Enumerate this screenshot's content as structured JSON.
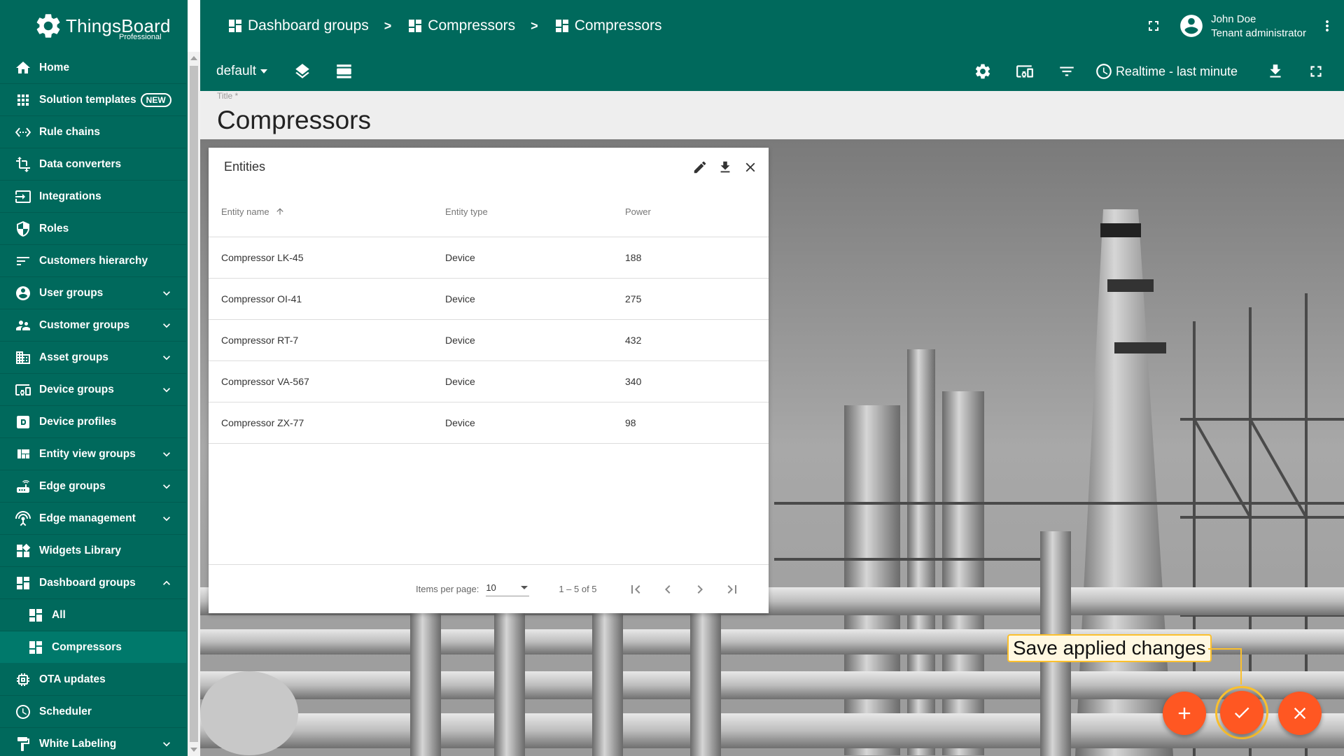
{
  "app": {
    "brand": "ThingsBoard",
    "edition": "Professional"
  },
  "sidebar": {
    "items": [
      {
        "label": "Home",
        "icon": "home-icon"
      },
      {
        "label": "Solution templates",
        "icon": "apps-icon",
        "badge": "NEW"
      },
      {
        "label": "Rule chains",
        "icon": "settings-ethernet-icon"
      },
      {
        "label": "Data converters",
        "icon": "transform-icon"
      },
      {
        "label": "Integrations",
        "icon": "input-icon"
      },
      {
        "label": "Roles",
        "icon": "security-icon"
      },
      {
        "label": "Customers hierarchy",
        "icon": "sort-icon"
      },
      {
        "label": "User groups",
        "icon": "account-circle-icon",
        "expandable": true
      },
      {
        "label": "Customer groups",
        "icon": "supervisor-account-icon",
        "expandable": true
      },
      {
        "label": "Asset groups",
        "icon": "domain-icon",
        "expandable": true
      },
      {
        "label": "Device groups",
        "icon": "devices-other-icon",
        "expandable": true
      },
      {
        "label": "Device profiles",
        "icon": "device-profile-icon"
      },
      {
        "label": "Entity view groups",
        "icon": "view-quilt-icon",
        "expandable": true
      },
      {
        "label": "Edge groups",
        "icon": "router-icon",
        "expandable": true
      },
      {
        "label": "Edge management",
        "icon": "settings-input-antenna-icon",
        "expandable": true
      },
      {
        "label": "Widgets Library",
        "icon": "widgets-icon"
      },
      {
        "label": "Dashboard groups",
        "icon": "dashboard-icon",
        "expanded": true
      },
      {
        "label": "All",
        "icon": "dashboard-icon",
        "sub": true
      },
      {
        "label": "Compressors",
        "icon": "dashboard-icon",
        "sub": true,
        "active": true
      },
      {
        "label": "OTA updates",
        "icon": "memory-icon"
      },
      {
        "label": "Scheduler",
        "icon": "schedule-icon"
      },
      {
        "label": "White Labeling",
        "icon": "format-paint-icon",
        "expandable": true
      }
    ]
  },
  "breadcrumb": {
    "items": [
      "Dashboard groups",
      "Compressors",
      "Compressors"
    ],
    "separator": ">"
  },
  "user": {
    "name": "John Doe",
    "role": "Tenant administrator"
  },
  "toolbar": {
    "state": "default",
    "timewindow": "Realtime - last minute"
  },
  "title_field": {
    "label": "Title *",
    "value": "Compressors"
  },
  "widget": {
    "title": "Entities",
    "columns": [
      "Entity name",
      "Entity type",
      "Power"
    ],
    "rows": [
      [
        "Compressor LK-45",
        "Device",
        "188"
      ],
      [
        "Compressor OI-41",
        "Device",
        "275"
      ],
      [
        "Compressor RT-7",
        "Device",
        "432"
      ],
      [
        "Compressor VA-567",
        "Device",
        "340"
      ],
      [
        "Compressor ZX-77",
        "Device",
        "98"
      ]
    ],
    "pager": {
      "items_per_page_label": "Items per page:",
      "items_per_page": "10",
      "range": "1 – 5 of 5"
    }
  },
  "tooltip": "Save applied changes",
  "colors": {
    "primary": "#00695c",
    "fab": "#ff5722",
    "highlight": "#fbc02d"
  }
}
